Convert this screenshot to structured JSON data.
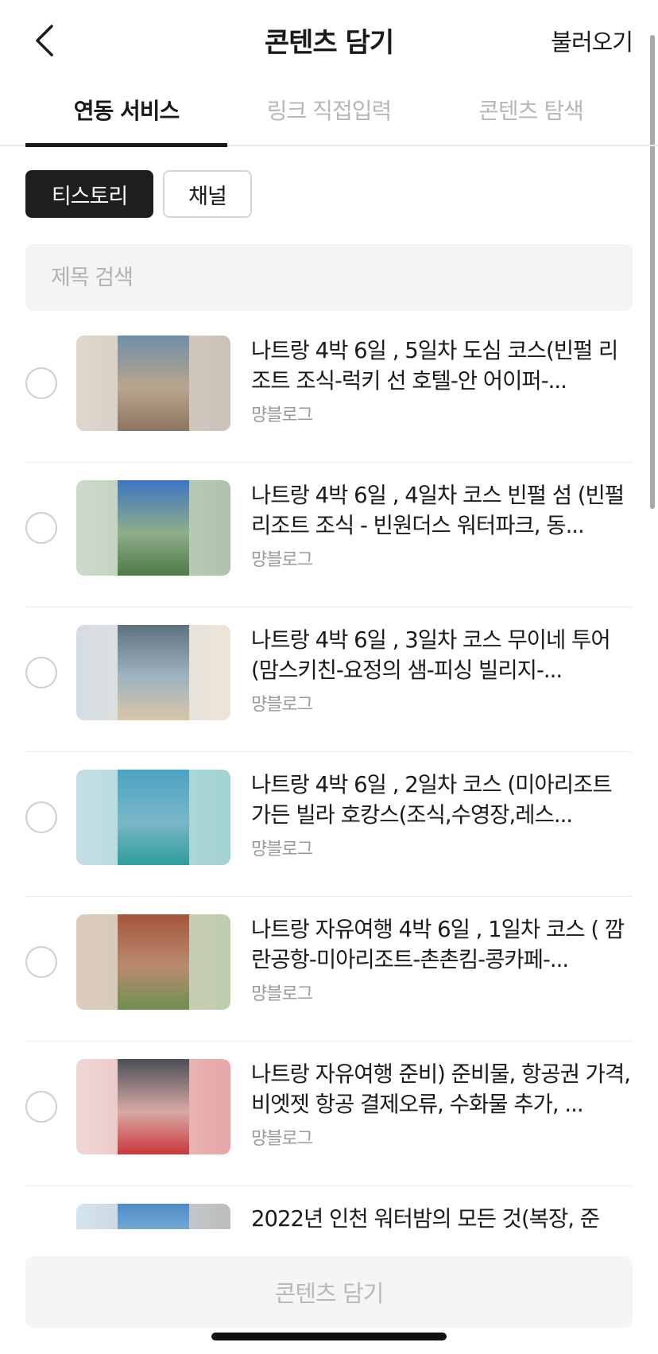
{
  "header": {
    "title": "콘텐츠 담기",
    "load_label": "불러오기",
    "back_icon": "chevron-left-icon"
  },
  "tabs": [
    {
      "label": "연동 서비스",
      "active": true
    },
    {
      "label": "링크 직접입력",
      "active": false
    },
    {
      "label": "콘텐츠 탐색",
      "active": false
    }
  ],
  "chips": [
    {
      "label": "티스토리",
      "selected": true
    },
    {
      "label": "채널",
      "selected": false
    }
  ],
  "search": {
    "placeholder": "제목 검색",
    "value": ""
  },
  "items": [
    {
      "title": "나트랑 4박 6일 , 5일차 도심 코스(빈펄 리조트 조식-럭키 선 호텔-안 어이퍼-...",
      "author": "먕블로그",
      "thumb_colors": [
        "#b9a58e",
        "#6f8fa8",
        "#8c7560"
      ]
    },
    {
      "title": "나트랑 4박 6일 , 4일차 코스 빈펄 섬 (빈펄리조트 조식 - 빈원더스 워터파크, 동...",
      "author": "먕블로그",
      "thumb_colors": [
        "#8fae8a",
        "#3c75c2",
        "#4d7a47"
      ]
    },
    {
      "title": "나트랑 4박 6일 , 3일차 코스 무이네 투어(맘스키친-요정의 샘-피싱 빌리지-...",
      "author": "먕블로그",
      "thumb_colors": [
        "#9fb3c0",
        "#5d7280",
        "#d8c6a8"
      ]
    },
    {
      "title": "나트랑 4박 6일 , 2일차 코스 (미아리조트 가든 빌라 호캉스(조식,수영장,레스...",
      "author": "먕블로그",
      "thumb_colors": [
        "#7ab7c7",
        "#4aa3c4",
        "#2f9d9b"
      ]
    },
    {
      "title": "나트랑 자유여행 4박 6일 , 1일차 코스 ( 깜란공항-미아리조트-촌촌킴-콩카페-...",
      "author": "먕블로그",
      "thumb_colors": [
        "#b98b70",
        "#a5553a",
        "#6e8f4f"
      ]
    },
    {
      "title": "나트랑 자유여행 준비) 준비물, 항공권 가격,비엣젯 항공 결제오류, 수화물 추가, ...",
      "author": "먕블로그",
      "thumb_colors": [
        "#d8a9a6",
        "#4a4f57",
        "#c9383a"
      ]
    },
    {
      "title": "2022년 인천 워터밤의 모든 것(복장, 준",
      "author": "",
      "thumb_colors": [
        "#9cc3de",
        "#4d8cc8",
        "#6a6a6a"
      ]
    }
  ],
  "footer": {
    "submit_label": "콘텐츠 담기"
  },
  "colors": {
    "active": "#1a1a1a",
    "inactive": "#b7b7b7",
    "chip_selected_bg": "#1e1e1e"
  }
}
